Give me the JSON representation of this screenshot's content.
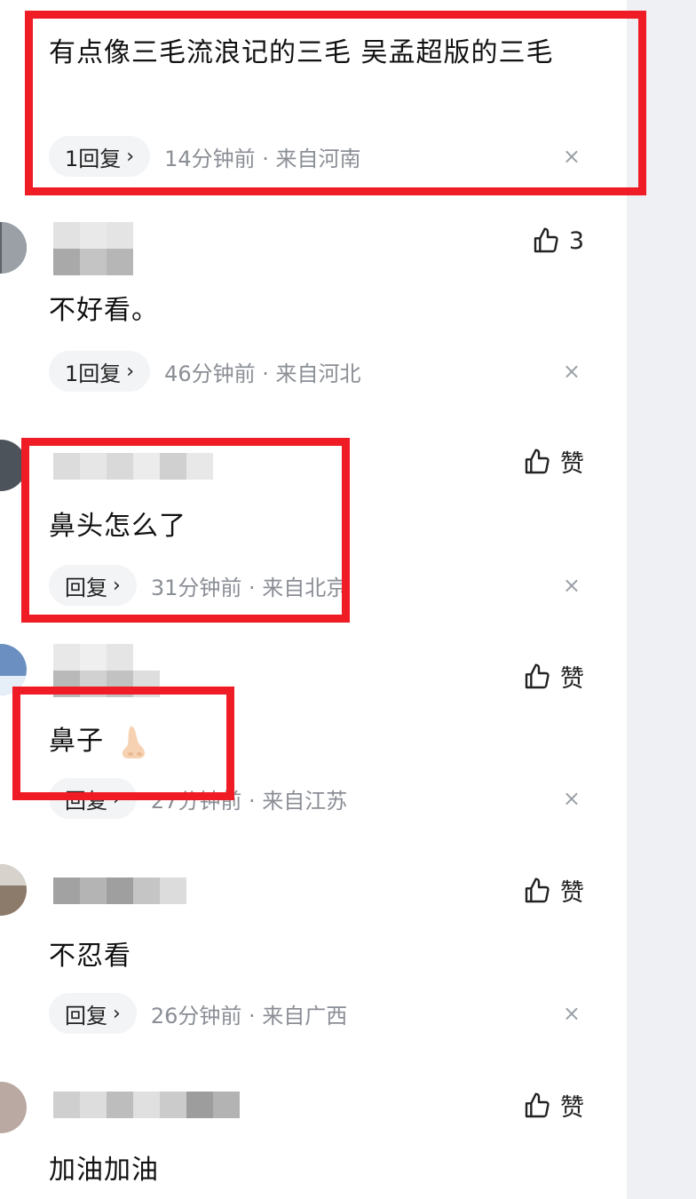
{
  "comments": [
    {
      "text": "有点像三毛流浪记的三毛 吴孟超版的三毛",
      "reply_label": "1回复",
      "time_location": "14分钟前 · 来自河南",
      "like_label": ""
    },
    {
      "text": "不好看。",
      "reply_label": "1回复",
      "time_location": "46分钟前 · 来自河北",
      "like_label": "3"
    },
    {
      "text": "鼻头怎么了",
      "reply_label": "回复",
      "time_location": "31分钟前 · 来自北京",
      "like_label": "赞"
    },
    {
      "text": "鼻子",
      "reply_label": "回复",
      "time_location": "27分钟前 · 来自江苏",
      "like_label": "赞"
    },
    {
      "text": "不忍看",
      "reply_label": "回复",
      "time_location": "26分钟前 · 来自广西",
      "like_label": "赞"
    },
    {
      "text": "加油加油",
      "reply_label": "",
      "time_location": "",
      "like_label": "赞"
    }
  ],
  "icons": {
    "like": "thumbs-up-icon",
    "close": "close-icon",
    "chevron": "chevron-right-icon",
    "nose_emoji": "nose-emoji-icon"
  },
  "colors": {
    "highlight_box": "#ef1c25",
    "reply_pill_bg": "#f3f4f6",
    "meta_text": "#8a8e95",
    "side_panel": "#eef0f3"
  },
  "glyphs": {
    "chevron": "›",
    "close": "×"
  }
}
